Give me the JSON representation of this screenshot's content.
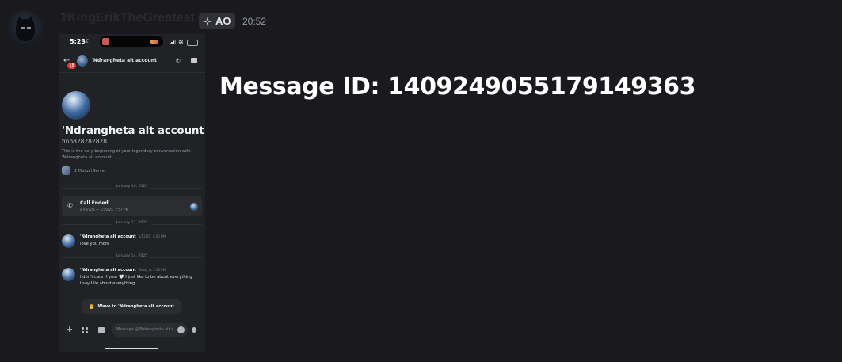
{
  "message": {
    "username": "1KingErikTheGreatest",
    "tag": "AO",
    "timestamp": "20:52",
    "overlay_text": "Message ID: 1409249055179149363"
  },
  "phone": {
    "status_time": "5:23",
    "chat_title": "'Ndrangheta alt account",
    "badge_count": "18",
    "profile": {
      "name": "'Ndrangheta alt account",
      "handle": "fino828282828",
      "description": "This is the very beginning of your legendary conversation with 'Ndrangheta alt account.",
      "mutual": "1 Mutual Server"
    },
    "dividers": [
      "January 10, 2025",
      "January 12, 2025",
      "January 14, 2025"
    ],
    "call_card": {
      "title": "Call Ended",
      "subtitle": "a minute — 1/10/25, 7:57 PM"
    },
    "messages": [
      {
        "author": "'Ndrangheta alt account",
        "time": "1/12/25, 4:40 PM",
        "lines": [
          "love you more"
        ]
      },
      {
        "author": "'Ndrangheta alt account",
        "time": "Today at 5:19 PM",
        "lines": [
          "I don't care if your 🤍 I just like to be about everything",
          "I say I lie about everything"
        ]
      }
    ],
    "wave_button": "Wave to 'Ndrangheta alt account",
    "input_placeholder": "Message @'Ndrangheta alt account"
  }
}
